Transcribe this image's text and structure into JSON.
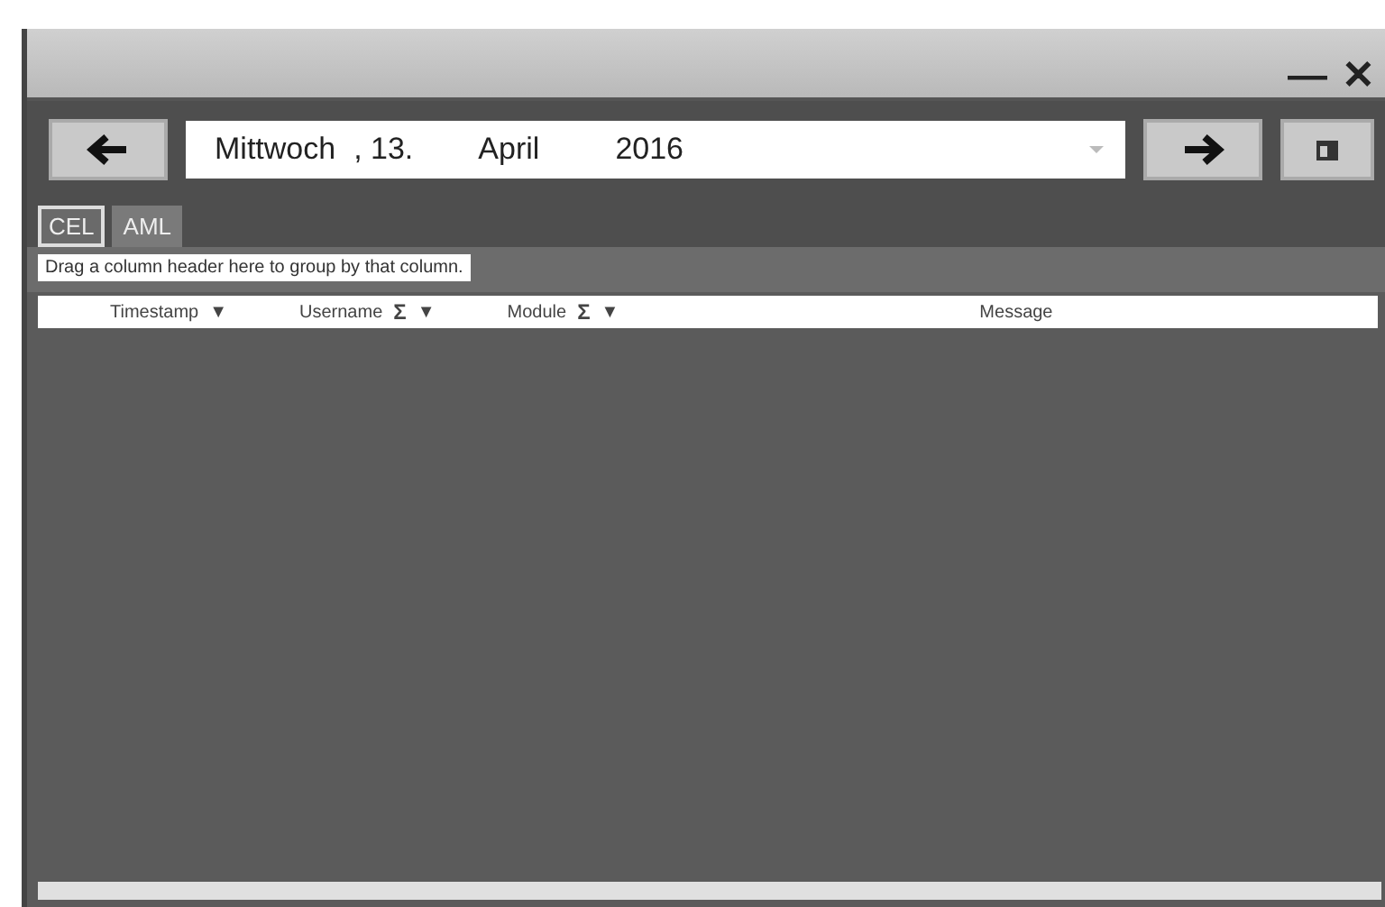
{
  "window": {
    "minimize": "—",
    "close": "✕"
  },
  "date_bar": {
    "weekday": "Mittwoch",
    "day": ", 13.",
    "month": "April",
    "year": "2016"
  },
  "tabs": [
    {
      "label": "CEL",
      "selected": true
    },
    {
      "label": "AML",
      "selected": false
    }
  ],
  "group_panel": {
    "hint": "Drag a column header here to group by that column."
  },
  "table": {
    "columns": [
      {
        "label": "Timestamp",
        "filter": "▼"
      },
      {
        "label": "Username",
        "sum": "Σ",
        "filter": "▼"
      },
      {
        "label": "Module",
        "sum": "Σ",
        "filter": "▼"
      },
      {
        "label": "Message"
      }
    ]
  }
}
